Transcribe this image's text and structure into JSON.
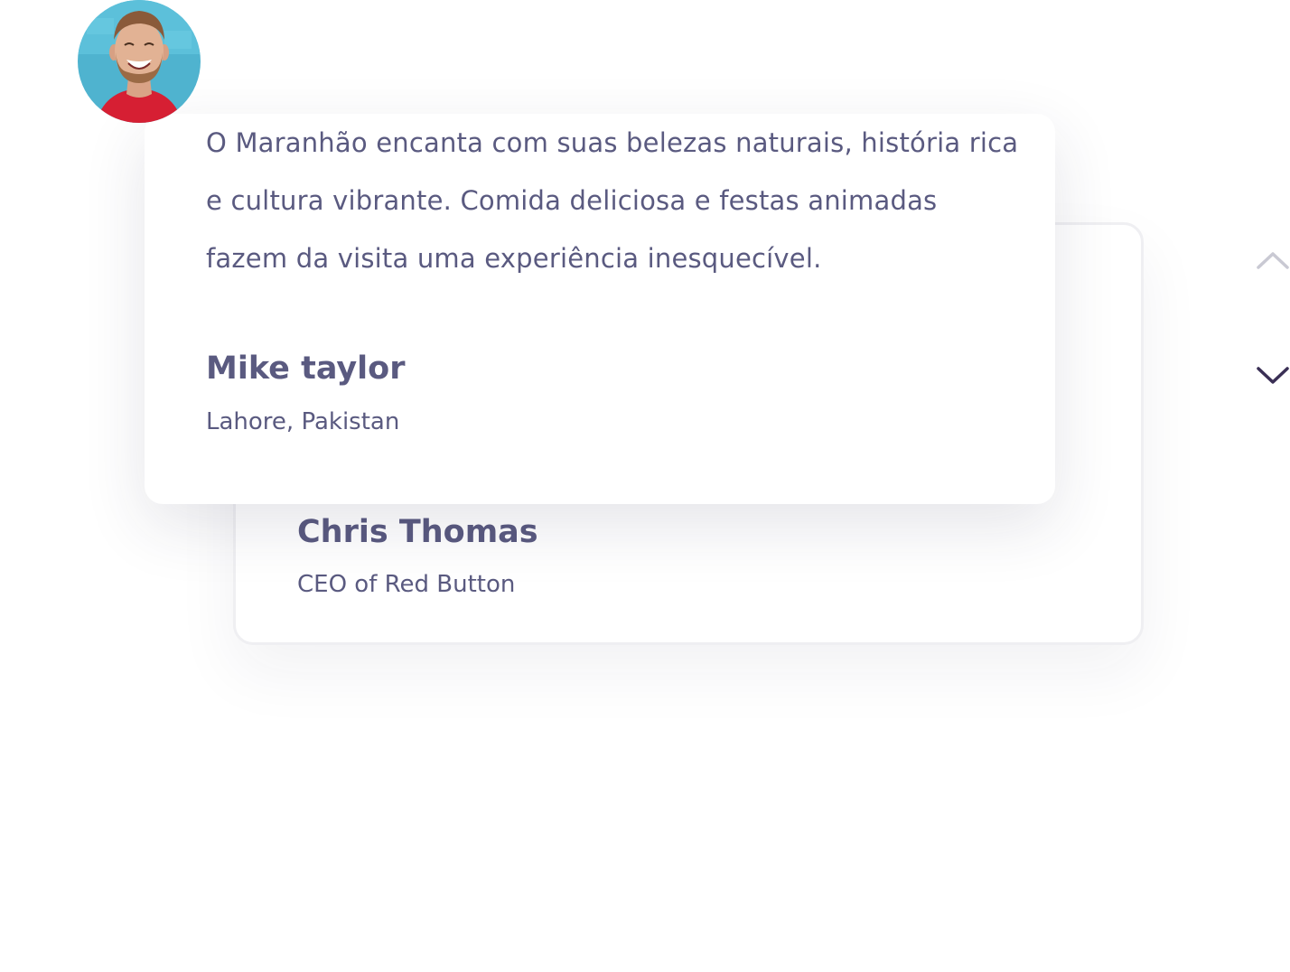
{
  "testimonials": {
    "active": {
      "quote": "O Maranhão encanta com suas belezas naturais, história rica e cultura vibrante. Comida deliciosa e festas animadas fazem da visita uma experiência inesquecível.",
      "name": "Mike taylor",
      "location": "Lahore, Pakistan",
      "avatar": "avatar-photo-smiling-man"
    },
    "next": {
      "name": "Chris Thomas",
      "role": "CEO of Red Button"
    }
  },
  "navigation": {
    "up_icon": "chevron-up-icon",
    "down_icon": "chevron-down-icon"
  },
  "colors": {
    "text": "#5a5a80",
    "arrow_inactive": "#c9c9d3",
    "arrow_active": "#3a2f55",
    "card_border": "#efeff2"
  }
}
